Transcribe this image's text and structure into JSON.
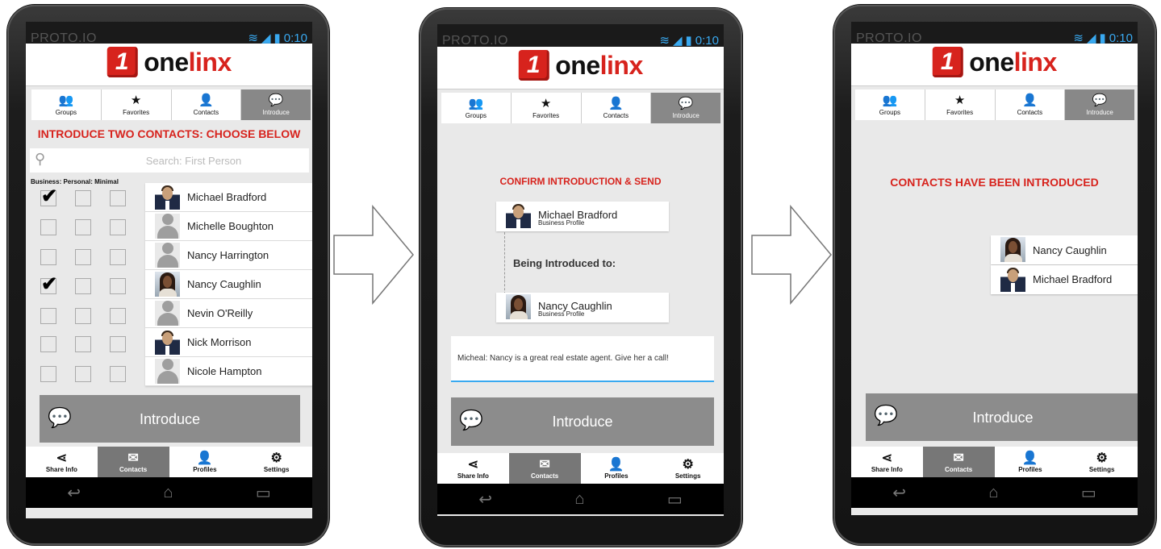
{
  "status": {
    "brand": "PROTO.IO",
    "time": "0:10"
  },
  "logo": {
    "mark": "1",
    "one": "one",
    "linx": "linx"
  },
  "tabs": [
    "Groups",
    "Favorites",
    "Contacts",
    "Introduce"
  ],
  "bottom_nav": [
    "Share Info",
    "Contacts",
    "Profiles",
    "Settings"
  ],
  "screen1": {
    "heading": "INTRODUCE TWO CONTACTS: CHOOSE BELOW",
    "search_placeholder": "Search: First Person",
    "column_headers": "Business: Personal: Minimal",
    "contacts": [
      {
        "name": "Michael Bradford",
        "business_checked": true,
        "avatar": "male-photo"
      },
      {
        "name": "Michelle Boughton",
        "business_checked": false,
        "avatar": "silhouette"
      },
      {
        "name": "Nancy Harrington",
        "business_checked": false,
        "avatar": "silhouette"
      },
      {
        "name": "Nancy Caughlin",
        "business_checked": true,
        "avatar": "female-photo"
      },
      {
        "name": "Nevin O'Reilly",
        "business_checked": false,
        "avatar": "silhouette"
      },
      {
        "name": "Nick Morrison",
        "business_checked": false,
        "avatar": "male-photo"
      },
      {
        "name": "Nicole Hampton",
        "business_checked": false,
        "avatar": "silhouette"
      }
    ],
    "button": "Introduce"
  },
  "screen2": {
    "heading": "CONFIRM INTRODUCTION & SEND",
    "person1": {
      "name": "Michael Bradford",
      "profile": "Business Profile"
    },
    "connector": "Being Introduced to:",
    "person2": {
      "name": "Nancy Caughlin",
      "profile": "Business Profile"
    },
    "message": "Micheal: Nancy is a great real estate agent.  Give her a call!",
    "button": "Introduce"
  },
  "screen3": {
    "heading": "CONTACTS HAVE BEEN INTRODUCED",
    "contacts": [
      "Nancy Caughlin",
      "Michael Bradford"
    ],
    "button": "Introduce"
  },
  "colors": {
    "accent": "#d7231d",
    "tab_active": "#888888",
    "button": "#8c8c8c",
    "text_input_underline": "#39a9f0"
  }
}
